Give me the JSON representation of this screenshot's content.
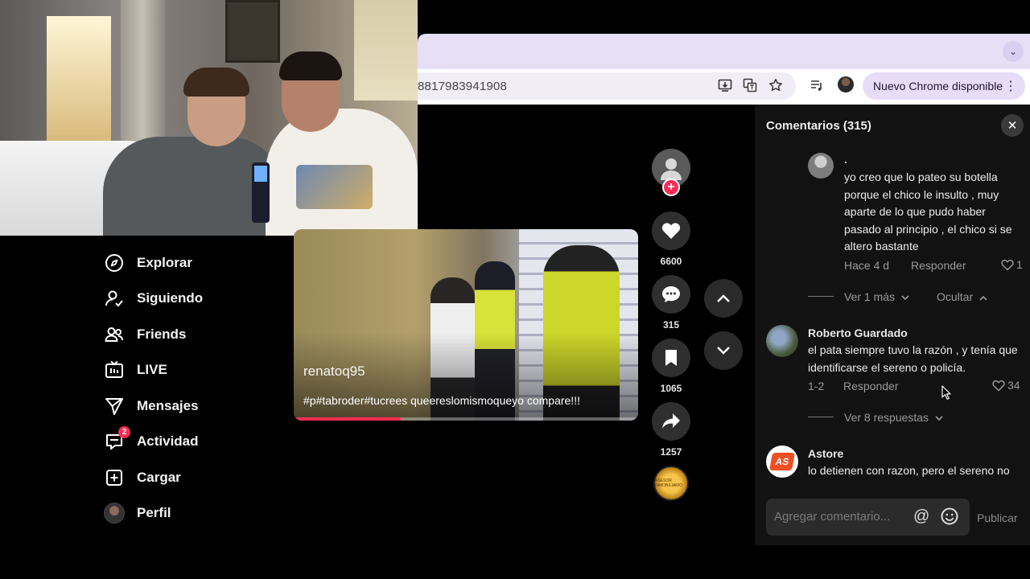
{
  "browser": {
    "url_fragment": "8817983941908",
    "update_label": "Nuevo Chrome disponible",
    "update_menu": "⋮",
    "tab_dropdown": "⌄"
  },
  "sidebar": {
    "items": [
      {
        "label": "Explorar",
        "icon": "compass-icon"
      },
      {
        "label": "Siguiendo",
        "icon": "user-follow-icon"
      },
      {
        "label": "Friends",
        "icon": "friends-icon"
      },
      {
        "label": "LIVE",
        "icon": "live-tv-icon"
      },
      {
        "label": "Mensajes",
        "icon": "send-icon"
      },
      {
        "label": "Actividad",
        "icon": "inbox-icon",
        "badge": "2"
      },
      {
        "label": "Cargar",
        "icon": "upload-icon"
      },
      {
        "label": "Perfil",
        "icon": "profile-avatar"
      }
    ]
  },
  "video": {
    "author": "renatoq95",
    "caption": "#p#tabroder#tucrees queereslomismoqueyo compare!!!",
    "progress": 0.31
  },
  "actions": {
    "likes": "6600",
    "comments": "315",
    "saves": "1065",
    "shares": "1257",
    "follow_plus": "+",
    "disc_label": "ASESOR INMOBILIARIO"
  },
  "comments_panel": {
    "title": "Comentarios (315)",
    "close_glyph": "✕",
    "reply1": {
      "name": ".",
      "text": "yo creo que lo pateo su botella porque el chico le insulto , muy aparte de lo que pudo haber pasado al principio , el chico si se altero bastante",
      "time": "Hace 4 d",
      "reply_label": "Responder",
      "likes": "1"
    },
    "thread1_more": "Ver 1 más",
    "thread1_hide": "Ocultar",
    "comment2": {
      "name": "Roberto Guardado",
      "text": "el pata siempre tuvo la razón , y tenía que identificarse el sereno o policía.",
      "time": "1-2",
      "reply_label": "Responder",
      "likes": "34"
    },
    "thread2_more": "Ver 8 respuestas",
    "comment3": {
      "name": "Astore",
      "text": "lo detienen con razon, pero el sereno no",
      "avatar_text": "AS"
    },
    "composer_placeholder": "Agregar comentario...",
    "at_glyph": "@",
    "post_label": "Publicar"
  },
  "colors": {
    "accent": "#fe2c55",
    "panel_bg": "#121212",
    "pill_bg": "#e8ddf8"
  }
}
